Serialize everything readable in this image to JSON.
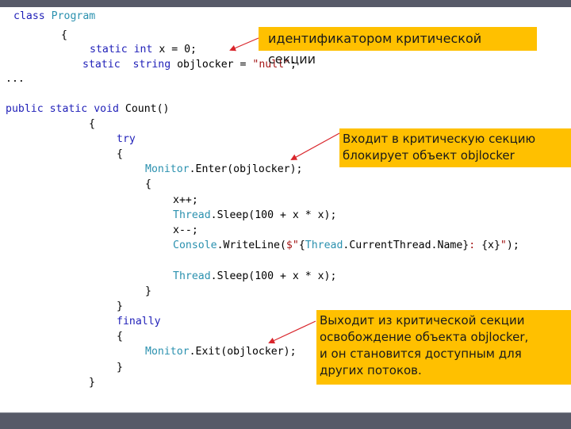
{
  "slide": {
    "colors": {
      "bar": "#575a68",
      "callout_bg": "#ffc000",
      "keyword": "#1f1fb8",
      "type": "#2b91af",
      "string": "#a31515",
      "arrow": "#d9262c"
    },
    "code": {
      "l1": {
        "kw": "class",
        "ty": "Program"
      },
      "l2": {
        "text": "{"
      },
      "l3": {
        "kw1": "static",
        "kw2": "int",
        "rest": " x = 0;"
      },
      "l4": {
        "kw1": "static",
        "kw2": "string",
        "mid": " objlocker = ",
        "str": "\"null\"",
        "end": ";"
      },
      "l5": {
        "text": "..."
      },
      "l6": {
        "kw1": "public",
        "kw2": "static",
        "kw3": "void",
        "rest": " Count()"
      },
      "l7": {
        "text": "{"
      },
      "l8": {
        "kw": "try"
      },
      "l9": {
        "text": "{"
      },
      "l10": {
        "ty": "Monitor",
        "rest": ".Enter(objlocker);"
      },
      "l11": {
        "text": "{"
      },
      "l12": {
        "text": "x++;"
      },
      "l13": {
        "ty": "Thread",
        "rest": ".Sleep(100 + x * x);"
      },
      "l14": {
        "text": "x--;"
      },
      "l15": {
        "ty": "Console",
        "mid": ".WriteLine(",
        "str1": "$\"",
        "brace1": "{",
        "ty2": "Thread",
        "mid2": ".CurrentThread.Name}",
        "str2": ": ",
        "rest": "{x}",
        "str3": "\"",
        "end": ");"
      },
      "l16": {
        "ty": "Thread",
        "rest": ".Sleep(100 + x * x);"
      },
      "l17": {
        "text": "}"
      },
      "l18": {
        "text": "}"
      },
      "l19": {
        "kw": "finally"
      },
      "l20": {
        "text": "{"
      },
      "l21": {
        "ty": "Monitor",
        "rest": ".Exit(objlocker);"
      },
      "l22": {
        "text": "}"
      },
      "l23": {
        "text": "}"
      }
    },
    "callouts": {
      "identifier": "идентификатором критической секции",
      "enter_line1": "Входит в критическую секцию",
      "enter_line2": "блокирует объект objlocker",
      "exit_line1": "Выходит из критической секции",
      "exit_line2": "освобождение объекта objlocker,",
      "exit_line3": "и он становится доступным для",
      "exit_line4": "других потоков."
    }
  }
}
